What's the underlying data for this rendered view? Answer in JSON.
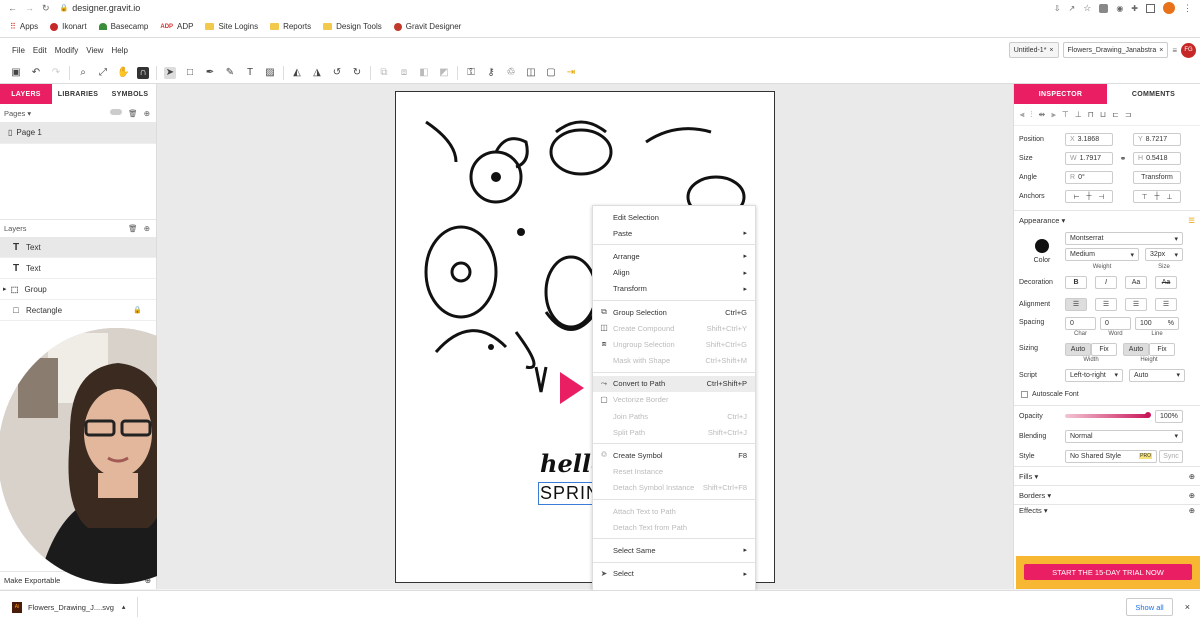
{
  "browser": {
    "url": "designer.gravit.io"
  },
  "bookmarks": [
    {
      "label": "Apps",
      "icon": "apps-grid-icon"
    },
    {
      "label": "Ikonart",
      "icon": "ikonart-icon"
    },
    {
      "label": "Basecamp",
      "icon": "basecamp-icon"
    },
    {
      "label": "ADP",
      "icon": "adp-icon"
    },
    {
      "label": "Site Logins",
      "icon": "folder-icon"
    },
    {
      "label": "Reports",
      "icon": "folder-icon"
    },
    {
      "label": "Design Tools",
      "icon": "folder-icon"
    },
    {
      "label": "Gravit Designer",
      "icon": "gravit-icon"
    }
  ],
  "menu": [
    "File",
    "Edit",
    "Modify",
    "View",
    "Help"
  ],
  "doc_tabs": {
    "tab1": "Untitled-1*",
    "tab2": "Flowers_Drawing_Janabstra",
    "avatar": "FG"
  },
  "left_panel": {
    "tabs": [
      "LAYERS",
      "LIBRARIES",
      "SYMBOLS"
    ],
    "pages_label": "Pages",
    "page_item": "Page 1",
    "layers_label": "Layers",
    "layers": [
      {
        "name": "Text",
        "icon": "T",
        "selected": true
      },
      {
        "name": "Text",
        "icon": "T",
        "selected": false
      },
      {
        "name": "Group",
        "icon": "group",
        "selected": false
      },
      {
        "name": "Rectangle",
        "icon": "rect",
        "selected": false
      }
    ],
    "make_exportable": "Make Exportable"
  },
  "artboard": {
    "text1": "hello",
    "text2": "SPRIN"
  },
  "context_menu": [
    {
      "label": "Edit Selection",
      "shortcut": "",
      "sub": false,
      "disabled": false
    },
    {
      "label": "Paste",
      "shortcut": "",
      "sub": true,
      "disabled": false
    },
    {
      "sep": true
    },
    {
      "label": "Arrange",
      "shortcut": "",
      "sub": true,
      "disabled": false
    },
    {
      "label": "Align",
      "shortcut": "",
      "sub": true,
      "disabled": false
    },
    {
      "label": "Transform",
      "shortcut": "",
      "sub": true,
      "disabled": false
    },
    {
      "sep": true
    },
    {
      "label": "Group Selection",
      "shortcut": "Ctrl+G",
      "sub": false,
      "disabled": false,
      "icon": "group"
    },
    {
      "label": "Create Compound",
      "shortcut": "Shift+Ctrl+Y",
      "sub": false,
      "disabled": true,
      "icon": "compound"
    },
    {
      "label": "Ungroup Selection",
      "shortcut": "Shift+Ctrl+G",
      "sub": false,
      "disabled": true,
      "icon": "ungroup"
    },
    {
      "label": "Mask with Shape",
      "shortcut": "Ctrl+Shift+M",
      "sub": false,
      "disabled": true
    },
    {
      "sep": true
    },
    {
      "label": "Convert to Path",
      "shortcut": "Ctrl+Shift+P",
      "sub": false,
      "disabled": false,
      "icon": "path",
      "highlight": true
    },
    {
      "label": "Vectorize Border",
      "shortcut": "",
      "sub": false,
      "disabled": true,
      "icon": "box"
    },
    {
      "label": "Join Paths",
      "shortcut": "Ctrl+J",
      "sub": false,
      "disabled": true
    },
    {
      "label": "Split Path",
      "shortcut": "Shift+Ctrl+J",
      "sub": false,
      "disabled": true
    },
    {
      "sep": true
    },
    {
      "label": "Create Symbol",
      "shortcut": "F8",
      "sub": false,
      "disabled": false,
      "icon": "symbol"
    },
    {
      "label": "Reset Instance",
      "shortcut": "",
      "sub": false,
      "disabled": true
    },
    {
      "label": "Detach Symbol Instance",
      "shortcut": "Shift+Ctrl+F8",
      "sub": false,
      "disabled": true
    },
    {
      "sep": true
    },
    {
      "label": "Attach Text to Path",
      "shortcut": "",
      "sub": false,
      "disabled": true
    },
    {
      "label": "Detach Text from Path",
      "shortcut": "",
      "sub": false,
      "disabled": true
    },
    {
      "sep": true
    },
    {
      "label": "Select Same",
      "shortcut": "",
      "sub": true,
      "disabled": false
    },
    {
      "sep": true
    },
    {
      "label": "Select",
      "shortcut": "",
      "sub": true,
      "disabled": false,
      "icon": "cursor"
    }
  ],
  "inspector": {
    "tabs": [
      "INSPECTOR",
      "COMMENTS"
    ],
    "position_label": "Position",
    "x_label": "X",
    "x": "3.1868",
    "y_label": "Y",
    "y": "8.7217",
    "size_label": "Size",
    "w_label": "W",
    "w": "1.7917",
    "h_label": "H",
    "h": "0.5418",
    "angle_label": "Angle",
    "r_label": "R",
    "angle": "0°",
    "transform": "Transform",
    "anchors_label": "Anchors",
    "appearance": "Appearance",
    "color_label": "Color",
    "font": "Montserrat",
    "weight": "Medium",
    "weight_label": "Weight",
    "size": "32px",
    "decoration_label": "Decoration",
    "alignment_label": "Alignment",
    "spacing_label": "Spacing",
    "char": "0",
    "word": "0",
    "line": "100",
    "pct": "%",
    "char_label": "Char",
    "word_label": "Word",
    "line_label": "Line",
    "sizing_label": "Sizing",
    "auto": "Auto",
    "fix": "Fix",
    "width_label": "Width",
    "height_label": "Height",
    "script_label": "Script",
    "script": "Left-to-right",
    "script2": "Auto",
    "autoscale": "Autoscale Font",
    "opacity_label": "Opacity",
    "opacity": "100%",
    "blending_label": "Blending",
    "blending": "Normal",
    "style_label": "Style",
    "style": "No Shared Style",
    "pro": "PRO",
    "sync": "Sync",
    "fills": "Fills",
    "borders": "Borders",
    "effects": "Effects",
    "trial": "START THE 15-DAY TRIAL NOW"
  },
  "download": {
    "file": "Flowers_Drawing_J....svg",
    "show_all": "Show all"
  },
  "colors": {
    "accent": "#e91e63",
    "trial_bg": "#f7b733"
  }
}
